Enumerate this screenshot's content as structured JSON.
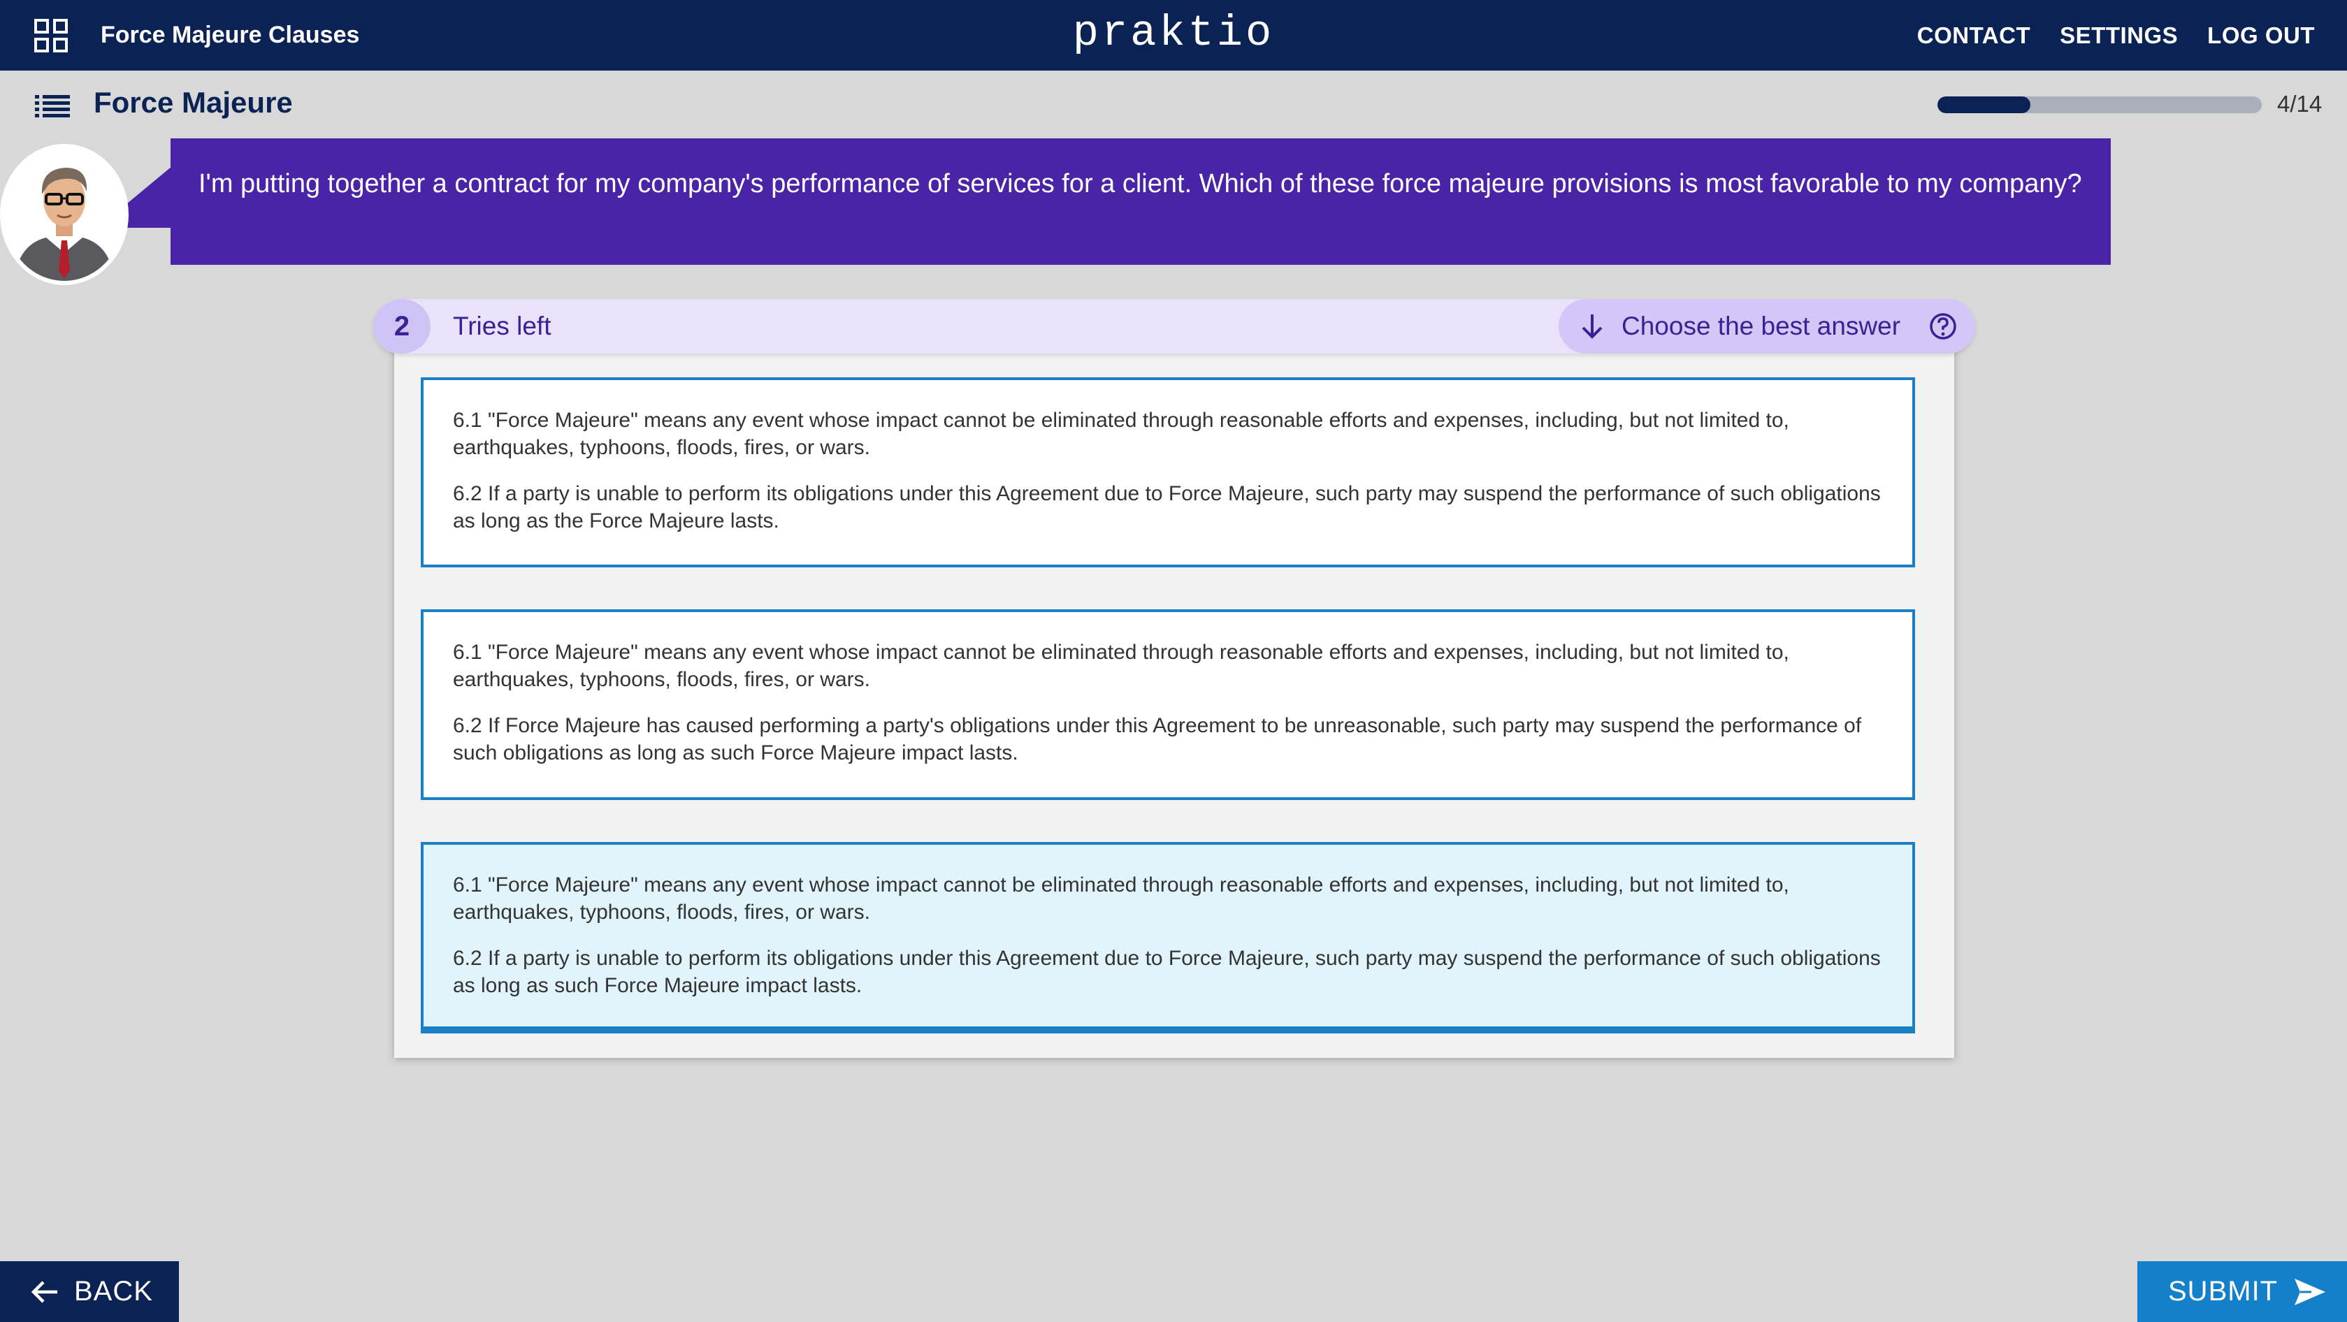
{
  "header": {
    "course_title": "Force Majeure Clauses",
    "logo_text": "praktio",
    "nav": [
      "CONTACT",
      "SETTINGS",
      "LOG OUT"
    ]
  },
  "lesson": {
    "title": "Force Majeure",
    "progress_text": "4/14",
    "progress_fraction": 0.2857
  },
  "question": {
    "prompt": "I'm putting together a contract for my company's performance of services for a client. Which of these force majeure provisions is most favorable to my company?",
    "tries_left": "2",
    "tries_label": "Tries left",
    "instruction": "Choose the best answer"
  },
  "options": [
    {
      "p1": "6.1 \"Force Majeure\" means any event whose impact cannot be eliminated through reasonable efforts and expenses, including, but not limited to, earthquakes, typhoons, floods, fires, or wars.",
      "p2": "6.2 If a party is unable to perform its obligations under this Agreement due to Force Majeure, such party may suspend the performance of such obligations as long as the Force Majeure lasts."
    },
    {
      "p1": "6.1 \"Force Majeure\" means any event whose impact cannot be eliminated through reasonable efforts and expenses, including, but not limited to, earthquakes, typhoons, floods, fires, or wars.",
      "p2": "6.2 If Force Majeure has caused performing a party's obligations under this Agreement to be unreasonable, such party may suspend the performance of such obligations as long as such Force Majeure impact lasts."
    },
    {
      "p1": "6.1 \"Force Majeure\" means any event whose impact cannot be eliminated through reasonable efforts and expenses, including, but not limited to, earthquakes, typhoons, floods, fires, or wars.",
      "p2": "6.2 If a party is unable to perform its obligations under this Agreement due to Force Majeure, such party may suspend the performance of such obligations as long as such Force Majeure impact lasts."
    }
  ],
  "footer": {
    "back_label": "BACK",
    "submit_label": "SUBMIT"
  },
  "colors": {
    "navy": "#0b2354",
    "purple": "#4a24a7",
    "option_border": "#1a7fc4",
    "selected_bg": "#e1f4fc",
    "submit": "#1480c9"
  },
  "icons": [
    "apps-grid-icon",
    "list-icon",
    "avatar-person-icon",
    "arrow-down-icon",
    "help-circle-icon",
    "arrow-left-icon",
    "send-icon"
  ]
}
